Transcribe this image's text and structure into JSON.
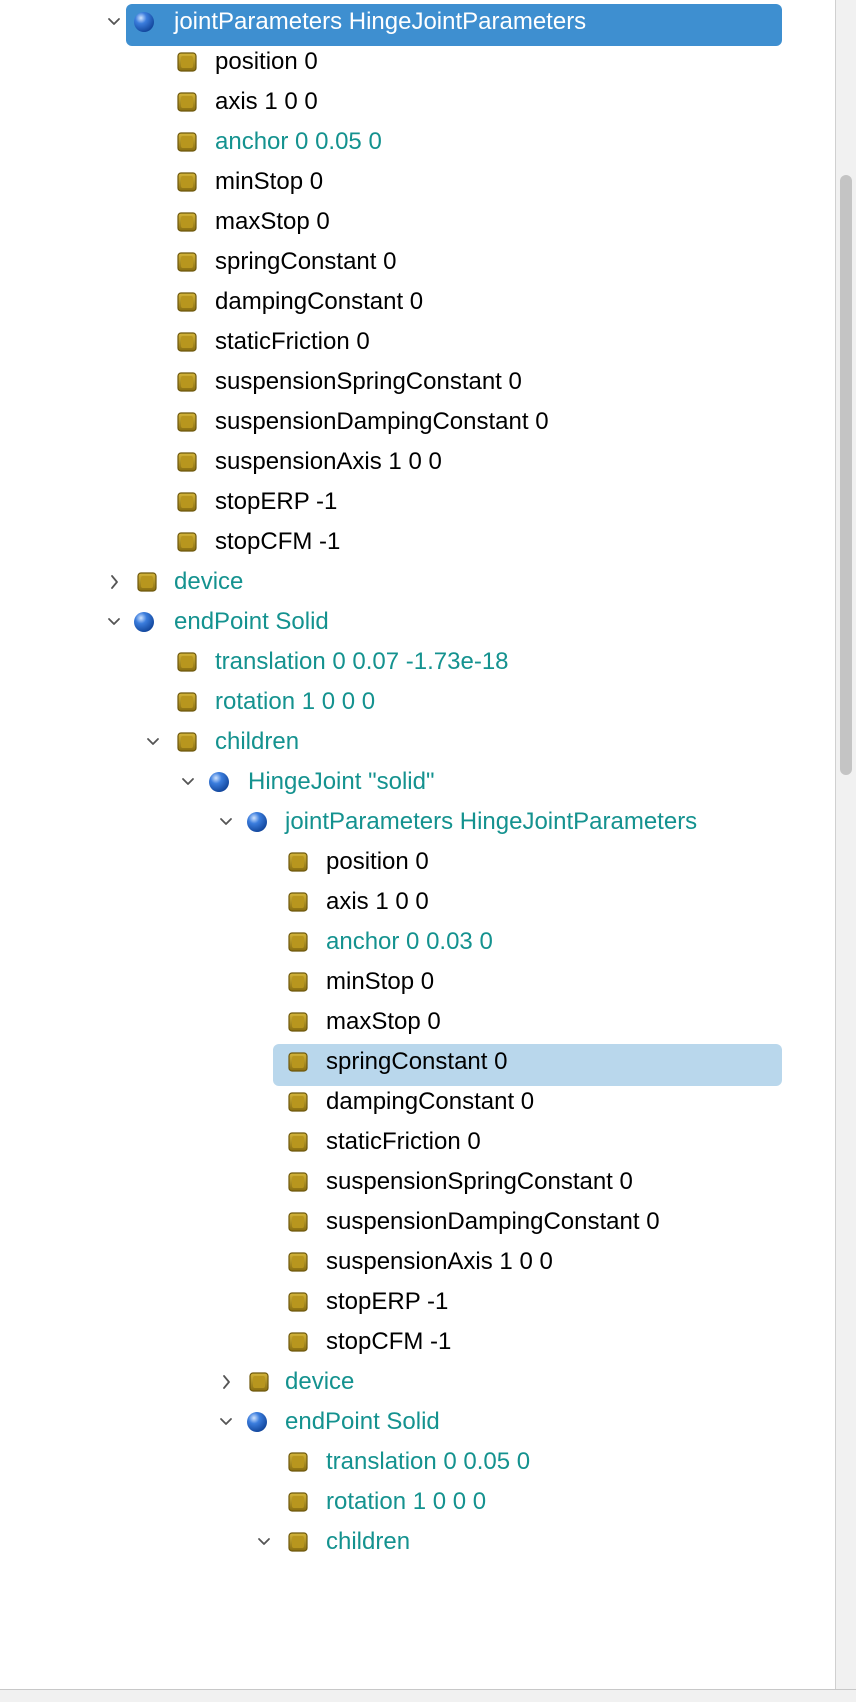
{
  "colors": {
    "selection_active": "#3e8fd0",
    "selection_inactive": "#b9d7ec",
    "modified_text": "#14928f",
    "default_text": "#000000"
  },
  "tree": {
    "rows": [
      {
        "label": "jointParameters HingeJointParameters",
        "icon": "node-sphere-icon",
        "expander": "expanded",
        "depth": 2,
        "style": "default",
        "selected": "active"
      },
      {
        "label": "position 0",
        "icon": "field-box-icon",
        "expander": "none",
        "depth": 3,
        "style": "default"
      },
      {
        "label": "axis 1 0 0",
        "icon": "field-box-icon",
        "expander": "none",
        "depth": 3,
        "style": "default"
      },
      {
        "label": "anchor 0 0.05 0",
        "icon": "field-box-icon",
        "expander": "none",
        "depth": 3,
        "style": "teal"
      },
      {
        "label": "minStop 0",
        "icon": "field-box-icon",
        "expander": "none",
        "depth": 3,
        "style": "default"
      },
      {
        "label": "maxStop 0",
        "icon": "field-box-icon",
        "expander": "none",
        "depth": 3,
        "style": "default"
      },
      {
        "label": "springConstant 0",
        "icon": "field-box-icon",
        "expander": "none",
        "depth": 3,
        "style": "default"
      },
      {
        "label": "dampingConstant 0",
        "icon": "field-box-icon",
        "expander": "none",
        "depth": 3,
        "style": "default"
      },
      {
        "label": "staticFriction 0",
        "icon": "field-box-icon",
        "expander": "none",
        "depth": 3,
        "style": "default"
      },
      {
        "label": "suspensionSpringConstant 0",
        "icon": "field-box-icon",
        "expander": "none",
        "depth": 3,
        "style": "default"
      },
      {
        "label": "suspensionDampingConstant 0",
        "icon": "field-box-icon",
        "expander": "none",
        "depth": 3,
        "style": "default"
      },
      {
        "label": "suspensionAxis 1 0 0",
        "icon": "field-box-icon",
        "expander": "none",
        "depth": 3,
        "style": "default"
      },
      {
        "label": "stopERP -1",
        "icon": "field-box-icon",
        "expander": "none",
        "depth": 3,
        "style": "default"
      },
      {
        "label": "stopCFM -1",
        "icon": "field-box-icon",
        "expander": "none",
        "depth": 3,
        "style": "default"
      },
      {
        "label": "device",
        "icon": "field-box-icon",
        "expander": "collapsed",
        "depth": 2,
        "style": "teal"
      },
      {
        "label": "endPoint Solid",
        "icon": "node-sphere-icon",
        "expander": "expanded",
        "depth": 2,
        "style": "teal"
      },
      {
        "label": "translation 0 0.07 -1.73e-18",
        "icon": "field-box-icon",
        "expander": "none",
        "depth": 3,
        "style": "teal"
      },
      {
        "label": "rotation 1 0 0 0",
        "icon": "field-box-icon",
        "expander": "none",
        "depth": 3,
        "style": "teal"
      },
      {
        "label": "children",
        "icon": "field-box-icon",
        "expander": "expanded",
        "depth": 3,
        "style": "teal"
      },
      {
        "label": "HingeJoint \"solid\"",
        "icon": "node-sphere-icon",
        "expander": "expanded",
        "depth": 4,
        "style": "teal"
      },
      {
        "label": "jointParameters HingeJointParameters",
        "icon": "node-sphere-icon",
        "expander": "expanded",
        "depth": 5,
        "style": "teal"
      },
      {
        "label": "position 0",
        "icon": "field-box-icon",
        "expander": "none",
        "depth": 6,
        "style": "default"
      },
      {
        "label": "axis 1 0 0",
        "icon": "field-box-icon",
        "expander": "none",
        "depth": 6,
        "style": "default"
      },
      {
        "label": "anchor 0 0.03 0",
        "icon": "field-box-icon",
        "expander": "none",
        "depth": 6,
        "style": "teal"
      },
      {
        "label": "minStop 0",
        "icon": "field-box-icon",
        "expander": "none",
        "depth": 6,
        "style": "default"
      },
      {
        "label": "maxStop 0",
        "icon": "field-box-icon",
        "expander": "none",
        "depth": 6,
        "style": "default"
      },
      {
        "label": "springConstant 0",
        "icon": "field-box-icon",
        "expander": "none",
        "depth": 6,
        "style": "default",
        "selected": "inactive"
      },
      {
        "label": "dampingConstant 0",
        "icon": "field-box-icon",
        "expander": "none",
        "depth": 6,
        "style": "default"
      },
      {
        "label": "staticFriction 0",
        "icon": "field-box-icon",
        "expander": "none",
        "depth": 6,
        "style": "default"
      },
      {
        "label": "suspensionSpringConstant 0",
        "icon": "field-box-icon",
        "expander": "none",
        "depth": 6,
        "style": "default"
      },
      {
        "label": "suspensionDampingConstant 0",
        "icon": "field-box-icon",
        "expander": "none",
        "depth": 6,
        "style": "default"
      },
      {
        "label": "suspensionAxis 1 0 0",
        "icon": "field-box-icon",
        "expander": "none",
        "depth": 6,
        "style": "default"
      },
      {
        "label": "stopERP -1",
        "icon": "field-box-icon",
        "expander": "none",
        "depth": 6,
        "style": "default"
      },
      {
        "label": "stopCFM -1",
        "icon": "field-box-icon",
        "expander": "none",
        "depth": 6,
        "style": "default"
      },
      {
        "label": "device",
        "icon": "field-box-icon",
        "expander": "collapsed",
        "depth": 5,
        "style": "teal"
      },
      {
        "label": "endPoint Solid",
        "icon": "node-sphere-icon",
        "expander": "expanded",
        "depth": 5,
        "style": "teal"
      },
      {
        "label": "translation 0 0.05 0",
        "icon": "field-box-icon",
        "expander": "none",
        "depth": 6,
        "style": "teal"
      },
      {
        "label": "rotation 1 0 0 0",
        "icon": "field-box-icon",
        "expander": "none",
        "depth": 6,
        "style": "teal"
      },
      {
        "label": "children",
        "icon": "field-box-icon",
        "expander": "expanded",
        "depth": 6,
        "style": "teal"
      }
    ]
  }
}
